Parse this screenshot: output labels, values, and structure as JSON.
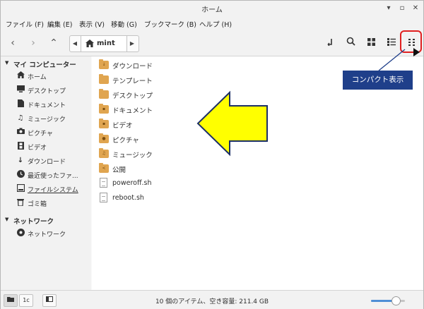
{
  "window": {
    "title": "ホーム",
    "minimize": "▾",
    "maximize": "▫",
    "close": "✕"
  },
  "menubar": [
    "ファイル (F)",
    "編集 (E)",
    "表示 (V)",
    "移動 (G)",
    "ブックマーク (B)",
    "ヘルプ (H)"
  ],
  "toolbar": {
    "breadcrumb": "mint"
  },
  "sidebar": {
    "computer_header": "マイ コンピューター",
    "computer_items": [
      {
        "label": "ホーム",
        "icon": "home-icon"
      },
      {
        "label": "デスクトップ",
        "icon": "desktop-icon"
      },
      {
        "label": "ドキュメント",
        "icon": "document-icon"
      },
      {
        "label": "ミュージック",
        "icon": "music-icon"
      },
      {
        "label": "ピクチャ",
        "icon": "camera-icon"
      },
      {
        "label": "ビデオ",
        "icon": "video-icon"
      },
      {
        "label": "ダウンロード",
        "icon": "download-icon"
      },
      {
        "label": "最近使ったファ...",
        "icon": "recent-icon"
      },
      {
        "label": "ファイルシステム",
        "icon": "drive-icon"
      },
      {
        "label": "ゴミ箱",
        "icon": "trash-icon"
      }
    ],
    "network_header": "ネットワーク",
    "network_items": [
      {
        "label": "ネットワーク",
        "icon": "network-icon"
      }
    ]
  },
  "files": [
    {
      "name": "ダウンロード",
      "kind": "folder",
      "glyph": "↓"
    },
    {
      "name": "テンプレート",
      "kind": "folder",
      "glyph": ""
    },
    {
      "name": "デスクトップ",
      "kind": "folder",
      "glyph": ""
    },
    {
      "name": "ドキュメント",
      "kind": "folder",
      "glyph": "▪"
    },
    {
      "name": "ビデオ",
      "kind": "folder",
      "glyph": "▪"
    },
    {
      "name": "ピクチャ",
      "kind": "folder",
      "glyph": "●"
    },
    {
      "name": "ミュージック",
      "kind": "folder",
      "glyph": "♫"
    },
    {
      "name": "公開",
      "kind": "folder",
      "glyph": "<"
    },
    {
      "name": "poweroff.sh",
      "kind": "file",
      "glyph": ""
    },
    {
      "name": "reboot.sh",
      "kind": "file",
      "glyph": ""
    }
  ],
  "statusbar": {
    "text": "10 個のアイテム、空き容量: 211.4 GB",
    "zoom": 0.72,
    "btn_1c": "1c"
  },
  "annotation": {
    "callout": "コンパクト表示"
  },
  "colors": {
    "accent": "#4f8fd6",
    "folder": "#e0a550",
    "callout_bg": "#1f3f8a",
    "arrow_fill": "#ffff00",
    "highlight": "#e02020"
  }
}
